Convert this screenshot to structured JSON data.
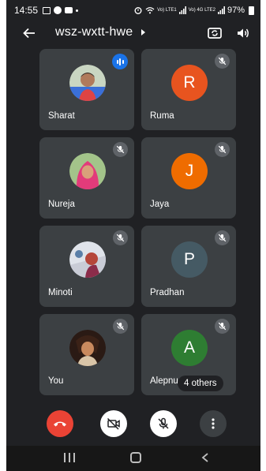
{
  "status_bar": {
    "time": "14:55",
    "network": "Vo) LTE1",
    "network2": "Vo) 4G LTE2",
    "battery": "97%"
  },
  "top_bar": {
    "meeting_code": "wsz-wxtt-hwe"
  },
  "participants": [
    {
      "name": "Sharat",
      "avatar_type": "photo",
      "status": "speaking"
    },
    {
      "name": "Ruma",
      "avatar_type": "letter",
      "letter": "R",
      "avatar_color": "#e8541f",
      "status": "muted"
    },
    {
      "name": "Nureja",
      "avatar_type": "photo",
      "status": "muted"
    },
    {
      "name": "Jaya",
      "avatar_type": "letter",
      "letter": "J",
      "avatar_color": "#ef6c00",
      "status": "muted"
    },
    {
      "name": "Minoti",
      "avatar_type": "photo",
      "status": "muted"
    },
    {
      "name": "Pradhan",
      "avatar_type": "letter",
      "letter": "P",
      "avatar_color": "#455a64",
      "status": "muted"
    },
    {
      "name": "You",
      "avatar_type": "photo",
      "status": "muted"
    },
    {
      "name": "Alepnu",
      "avatar_type": "letter",
      "letter": "A",
      "avatar_color": "#2e7d32",
      "status": "muted"
    }
  ],
  "others_label": "4 others",
  "colors": {
    "background": "#202124",
    "tile": "#3c4043",
    "end_call": "#ea4335",
    "speaking": "#1a73e8"
  },
  "icons": {
    "back": "arrow-left-icon",
    "switch_camera": "switch-camera-icon",
    "speaker": "speaker-icon",
    "mic_off": "mic-off-icon",
    "cam_off": "video-off-icon",
    "end_call": "phone-hangup-icon",
    "more": "more-vert-icon"
  }
}
